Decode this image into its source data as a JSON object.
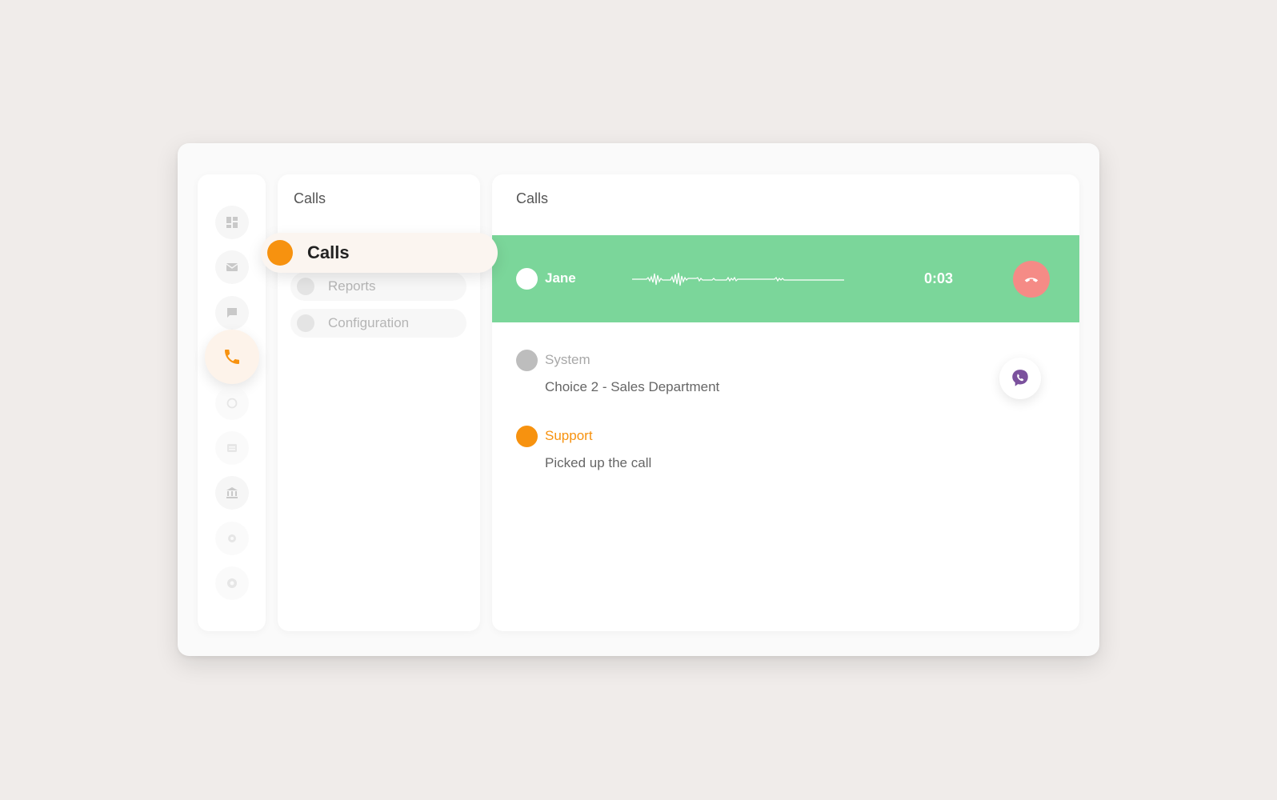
{
  "rail": {
    "items": [
      {
        "icon": "dashboard-icon"
      },
      {
        "icon": "mail-icon"
      },
      {
        "icon": "chat-icon"
      },
      {
        "icon": "phone-icon",
        "active": true
      },
      {
        "icon": "refresh-icon"
      },
      {
        "icon": "inbox-icon"
      },
      {
        "icon": "bank-icon"
      },
      {
        "icon": "gear-icon"
      },
      {
        "icon": "record-icon"
      }
    ]
  },
  "submenu": {
    "title": "Calls",
    "active_item": "Calls",
    "items": [
      {
        "label": "Reports"
      },
      {
        "label": "Configuration"
      }
    ]
  },
  "main": {
    "title": "Calls",
    "active_call": {
      "caller": "Jane",
      "duration": "0:03"
    },
    "log": [
      {
        "author": "System",
        "message": "Choice 2 - Sales Department",
        "color": "#bdbdbd",
        "author_color": "#a8a8a8"
      },
      {
        "author": "Support",
        "message": "Picked up the call",
        "color": "#f7920f",
        "author_color": "#f7920f"
      }
    ]
  },
  "colors": {
    "accent": "#f7920f",
    "call_bar": "#7bd69a",
    "hangup": "#f58b86",
    "viber": "#7b519d"
  }
}
